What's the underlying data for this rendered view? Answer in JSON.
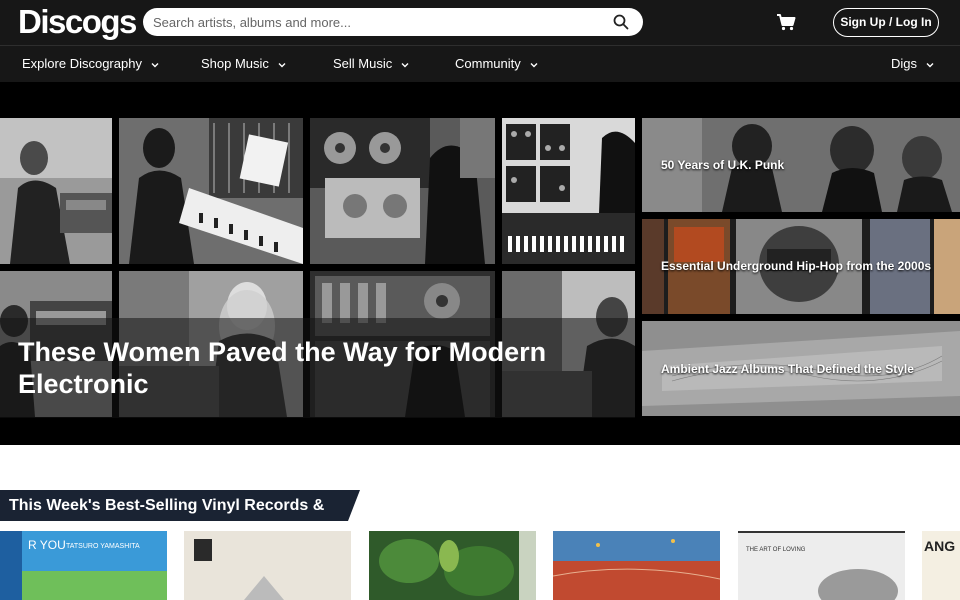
{
  "header": {
    "logo": "Discogs",
    "search_placeholder": "Search artists, albums and more...",
    "signup_label": "Sign Up / Log In"
  },
  "nav": {
    "items": [
      {
        "label": "Explore Discography"
      },
      {
        "label": "Shop Music"
      },
      {
        "label": "Sell Music"
      },
      {
        "label": "Community"
      },
      {
        "label": "Digs"
      }
    ]
  },
  "hero": {
    "main_title": "These Women Paved the Way for Modern Electronic",
    "features": [
      {
        "label": "50 Years of U.K. Punk"
      },
      {
        "label": "Essential Underground Hip-Hop from the 2000s"
      },
      {
        "label": "Ambient Jazz Albums That Defined the Style"
      }
    ]
  },
  "bestsellers": {
    "heading": "This Week's Best-Selling Vinyl Records & CDs",
    "records": [
      {
        "cover_text": "R YOU",
        "cover_subtext": "TATSURO YAMASHITA"
      },
      {
        "cover_text": ""
      },
      {
        "cover_text": ""
      },
      {
        "cover_text": ""
      },
      {
        "cover_text": "THE ART OF LOVING"
      },
      {
        "cover_text": "ANG"
      }
    ]
  },
  "colors": {
    "header_bg": "#171717",
    "hero_bg": "#000000",
    "banner_bg": "#1a2333"
  }
}
